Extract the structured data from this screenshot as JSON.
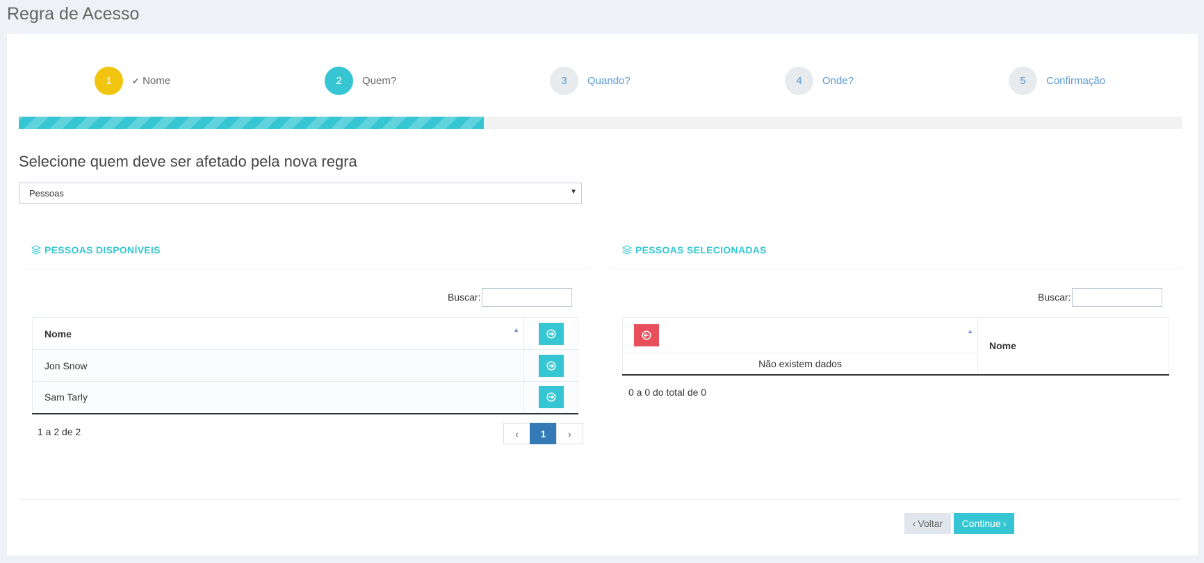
{
  "page": {
    "title": "Regra de Acesso"
  },
  "wizard": {
    "steps": [
      {
        "number": "1",
        "label": "Nome",
        "state": "done"
      },
      {
        "number": "2",
        "label": "Quem?",
        "state": "active"
      },
      {
        "number": "3",
        "label": "Quando?",
        "state": "todo"
      },
      {
        "number": "4",
        "label": "Onde?",
        "state": "todo"
      },
      {
        "number": "5",
        "label": "Confirmação",
        "state": "todo"
      }
    ],
    "progress_percent": 40
  },
  "form": {
    "heading": "Selecione quem deve ser afetado pela nova regra",
    "type_select_value": "Pessoas"
  },
  "available": {
    "title": "PESSOAS DISPONÍVEIS",
    "search_label": "Buscar:",
    "column_name": "Nome",
    "rows": [
      {
        "name": "Jon Snow"
      },
      {
        "name": "Sam Tarly"
      }
    ],
    "info": "1 a 2 de 2",
    "pagination": {
      "prev": "‹",
      "current": "1",
      "next": "›"
    }
  },
  "selected": {
    "title": "PESSOAS SELECIONADAS",
    "search_label": "Buscar:",
    "column_name": "Nome",
    "empty_text": "Não existem dados",
    "info": "0 a 0 do total de 0"
  },
  "footer": {
    "back_label": "Voltar",
    "continue_label": "Continue"
  },
  "colors": {
    "accent": "#36c6d3",
    "done": "#f1c40f",
    "danger": "#e7505a",
    "primary": "#337ab7"
  }
}
